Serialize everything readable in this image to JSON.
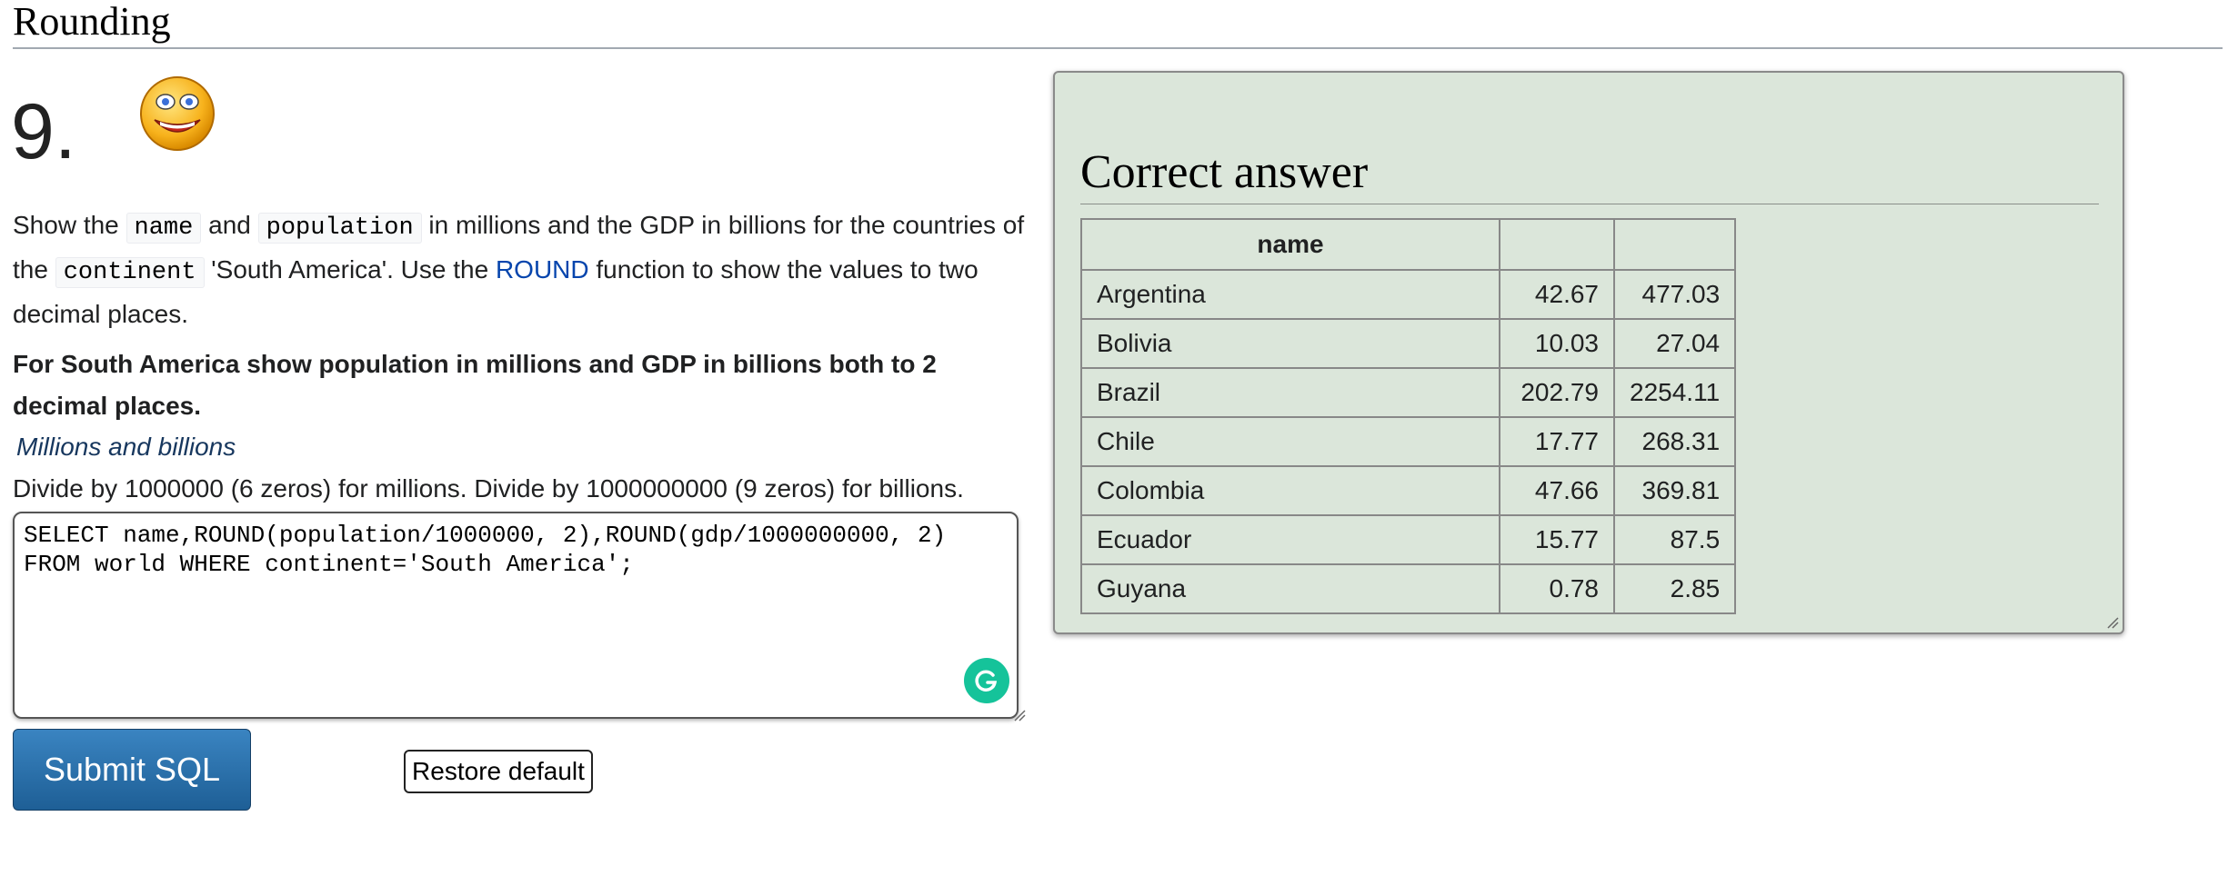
{
  "section": {
    "title": "Rounding"
  },
  "question": {
    "number": "9.",
    "text_1": "Show the ",
    "code_name": "name",
    "text_2": " and ",
    "code_population": "population",
    "text_3": " in millions and the GDP in billions for the countries of the ",
    "code_continent": "continent",
    "text_4": " 'South America'. Use the ",
    "link_round": "ROUND",
    "text_5": " function to show the values to two decimal places.",
    "bold_instruction": "For South America show population in millions and GDP in billions both to 2 decimal places.",
    "hint_label": "Millions and billions",
    "hint_text": "Divide by 1000000 (6 zeros) for millions. Divide by 1000000000 (9 zeros) for billions."
  },
  "editor": {
    "sql": "SELECT name,ROUND(population/1000000, 2),ROUND(gdp/1000000000, 2)\nFROM world WHERE continent='South America';"
  },
  "buttons": {
    "submit": "Submit SQL",
    "restore": "Restore default"
  },
  "answer": {
    "title": "Correct answer",
    "headers": [
      "name",
      "",
      ""
    ],
    "rows": [
      [
        "Argentina",
        "42.67",
        "477.03"
      ],
      [
        "Bolivia",
        "10.03",
        "27.04"
      ],
      [
        "Brazil",
        "202.79",
        "2254.11"
      ],
      [
        "Chile",
        "17.77",
        "268.31"
      ],
      [
        "Colombia",
        "47.66",
        "369.81"
      ],
      [
        "Ecuador",
        "15.77",
        "87.5"
      ],
      [
        "Guyana",
        "0.78",
        "2.85"
      ]
    ]
  },
  "colors": {
    "answer_bg": "#dbe6da",
    "submit_bg": "#2a72ad",
    "link": "#0645ad",
    "grammarly": "#15c39a"
  },
  "icons": {
    "smiley": "smiley-face-icon",
    "grammarly": "grammarly-icon"
  }
}
